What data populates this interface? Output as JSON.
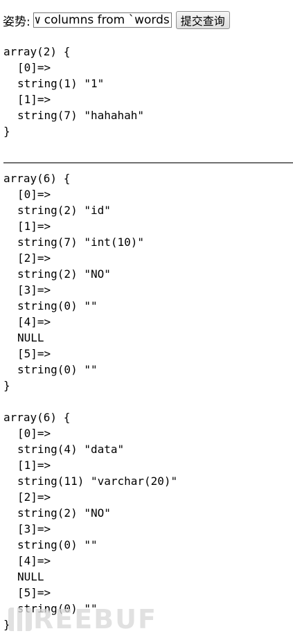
{
  "form": {
    "label": "姿势:",
    "input_value": "show columns from `words`#",
    "submit_label": "提交查询"
  },
  "dump1": {
    "open": "array(2) {",
    "lines": [
      "[0]=>",
      "string(1) \"1\"",
      "[1]=>",
      "string(7) \"hahahah\""
    ],
    "close": "}"
  },
  "dump2": {
    "open": "array(6) {",
    "lines": [
      "[0]=>",
      "string(2) \"id\"",
      "[1]=>",
      "string(7) \"int(10)\"",
      "[2]=>",
      "string(2) \"NO\"",
      "[3]=>",
      "string(0) \"\"",
      "[4]=>",
      "NULL",
      "[5]=>",
      "string(0) \"\""
    ],
    "close": "}"
  },
  "dump3": {
    "open": "array(6) {",
    "lines": [
      "[0]=>",
      "string(4) \"data\"",
      "[1]=>",
      "string(11) \"varchar(20)\"",
      "[2]=>",
      "string(2) \"NO\"",
      "[3]=>",
      "string(0) \"\"",
      "[4]=>",
      "NULL",
      "[5]=>",
      "string(0) \"\""
    ],
    "close": "}"
  },
  "watermark": {
    "text": "REEBUF"
  }
}
